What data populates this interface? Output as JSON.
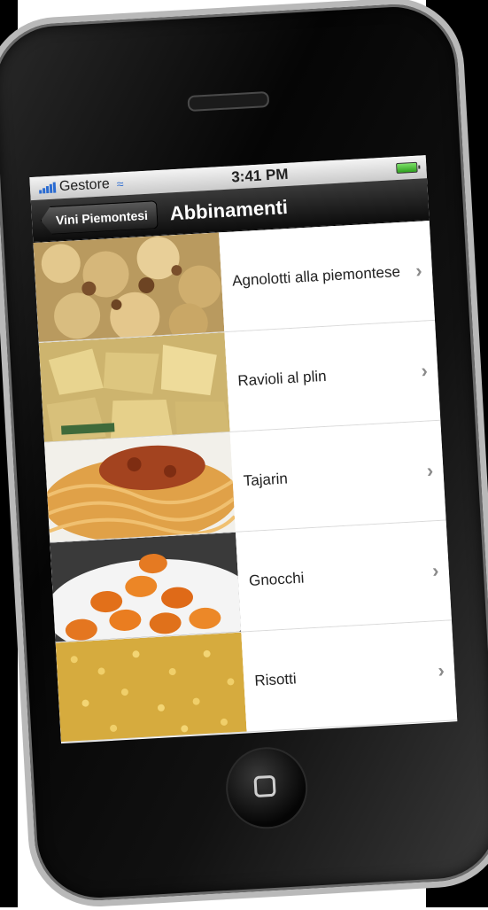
{
  "status_bar": {
    "carrier": "Gestore",
    "time": "3:41 PM"
  },
  "nav_bar": {
    "back_label": "Vini Piemontesi",
    "title": "Abbinamenti"
  },
  "dishes": [
    {
      "label": "Agnolotti alla piemontese",
      "thumb_color": "#c9a96a"
    },
    {
      "label": "Ravioli al plin",
      "thumb_color": "#d7c481"
    },
    {
      "label": "Tajarin",
      "thumb_color": "#d99a3c"
    },
    {
      "label": "Gnocchi",
      "thumb_color": "#e07a1e"
    },
    {
      "label": "Risotti",
      "thumb_color": "#d4a83a"
    }
  ],
  "colors": {
    "nav_bar": "#1a1a1a",
    "status_bar": "#dcdcdc",
    "accent_blue": "#2a6bd1"
  }
}
